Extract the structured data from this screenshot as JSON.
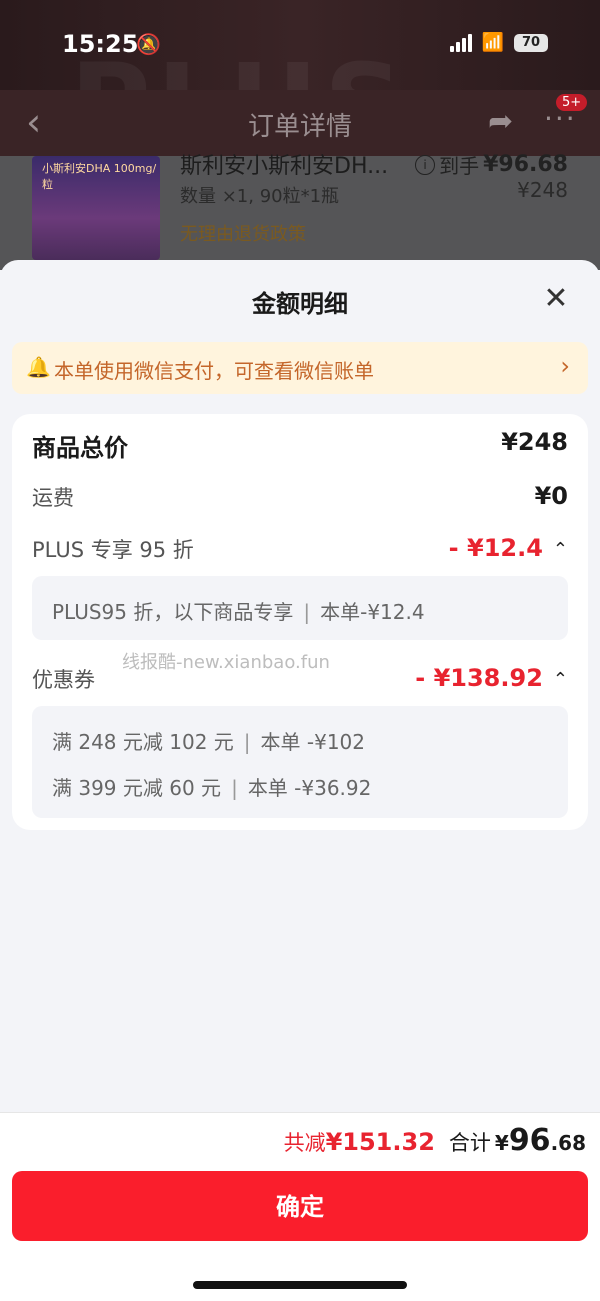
{
  "status_bar": {
    "time": "15:25",
    "battery": "70"
  },
  "nav": {
    "title": "订单详情",
    "badge": "5+",
    "watermark": "PLUS"
  },
  "product": {
    "thumb_label": "小斯利安DHA 100mg/粒",
    "name": "斯利安小斯利安DH...",
    "price_label": "到手",
    "price": "¥96.68",
    "orig_price": "¥248",
    "qty": "数量 ×1, 90粒*1瓶",
    "policy": "无理由退货政策"
  },
  "sheet": {
    "title": "金额明细",
    "notice": "本单使用微信支付，可查看微信账单",
    "rows": {
      "goods_total": {
        "label": "商品总价",
        "value": "¥248"
      },
      "shipping": {
        "label": "运费",
        "value": "¥0"
      },
      "plus": {
        "label": "PLUS 专享 95 折",
        "value": "- ¥12.4",
        "detail_left": "PLUS95 折，以下商品专享",
        "detail_right": "本单-¥12.4"
      },
      "coupon": {
        "label": "优惠券",
        "value": "- ¥138.92",
        "details": [
          {
            "left": "满 248 元减 102 元",
            "right": "本单 -¥102"
          },
          {
            "left": "满 399 元减 60 元",
            "right": "本单 -¥36.92"
          }
        ]
      }
    },
    "watermark_text": "线报酷-new.xianbao.fun"
  },
  "footer": {
    "saved_label": "共减",
    "saved_value": "¥151.32",
    "total_label": "合计",
    "total_symbol": "¥",
    "total_int": "96",
    "total_dec": ".68",
    "confirm": "确定"
  },
  "colors": {
    "accent": "#fa1e2c",
    "discount_red": "#e8232f",
    "notice_bg": "#fff4dd",
    "notice_text": "#c4662a"
  }
}
